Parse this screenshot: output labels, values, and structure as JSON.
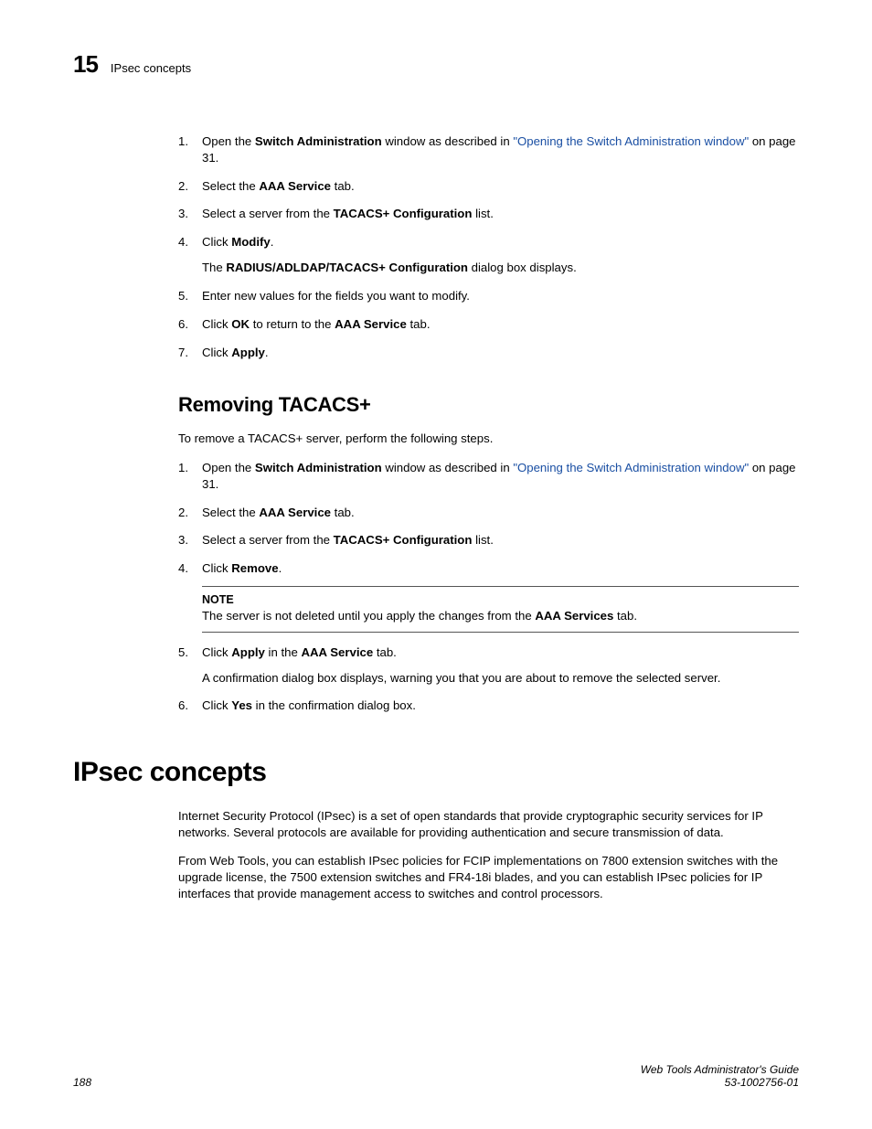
{
  "header": {
    "chapter_number": "15",
    "chapter_title": "IPsec concepts"
  },
  "section1": {
    "steps": [
      {
        "num": "1.",
        "pre": "Open the ",
        "b1": "Switch Administration",
        "mid": " window as described in ",
        "link": "\"Opening the Switch Administration window\"",
        "post": " on page 31."
      },
      {
        "num": "2.",
        "pre": "Select the ",
        "b1": "AAA Service",
        "post": " tab."
      },
      {
        "num": "3.",
        "pre": "Select a server from the ",
        "b1": "TACACS+ Configuration",
        "post": " list."
      },
      {
        "num": "4.",
        "pre": "Click ",
        "b1": "Modify",
        "post": ".",
        "follow_pre": "The ",
        "follow_b": "RADIUS/ADLDAP/TACACS+ Configuration",
        "follow_post": " dialog box displays."
      },
      {
        "num": "5.",
        "pre": "Enter new values for the fields you want to modify."
      },
      {
        "num": "6.",
        "pre": "Click ",
        "b1": "OK",
        "mid": " to return to the ",
        "b2": "AAA Service",
        "post": " tab."
      },
      {
        "num": "7.",
        "pre": "Click ",
        "b1": "Apply",
        "post": "."
      }
    ]
  },
  "section2": {
    "heading": "Removing TACACS+",
    "intro": "To remove a TACACS+ server, perform the following steps.",
    "steps": [
      {
        "num": "1.",
        "pre": "Open the ",
        "b1": "Switch Administration",
        "mid": " window as described in ",
        "link": "\"Opening the Switch Administration window\"",
        "post": " on page 31."
      },
      {
        "num": "2.",
        "pre": "Select the ",
        "b1": "AAA Service",
        "post": " tab."
      },
      {
        "num": "3.",
        "pre": "Select a server from the ",
        "b1": "TACACS+ Configuration",
        "post": " list."
      },
      {
        "num": "4.",
        "pre": "Click ",
        "b1": "Remove",
        "post": ".",
        "note_label": "NOTE",
        "note_pre": "The server is not deleted until you apply the changes from the ",
        "note_b": "AAA Services",
        "note_post": " tab."
      },
      {
        "num": "5.",
        "pre": "Click ",
        "b1": "Apply",
        "mid": " in the ",
        "b2": "AAA Service",
        "post": " tab.",
        "follow_pre": "A confirmation dialog box displays, warning you that you are about to remove the selected server."
      },
      {
        "num": "6.",
        "pre": "Click ",
        "b1": "Yes",
        "post": " in the confirmation dialog box."
      }
    ]
  },
  "section3": {
    "heading": "IPsec concepts",
    "para1": "Internet Security Protocol (IPsec) is a set of open standards that provide cryptographic security services for IP networks. Several protocols are available for providing authentication and secure transmission of data.",
    "para2": "From Web Tools, you can establish IPsec policies for FCIP implementations on 7800 extension switches with the upgrade license, the 7500 extension switches and FR4-18i blades, and you can establish IPsec policies for IP interfaces that provide management access to switches and control processors."
  },
  "footer": {
    "page": "188",
    "title": "Web Tools Administrator's Guide",
    "docnum": "53-1002756-01"
  }
}
